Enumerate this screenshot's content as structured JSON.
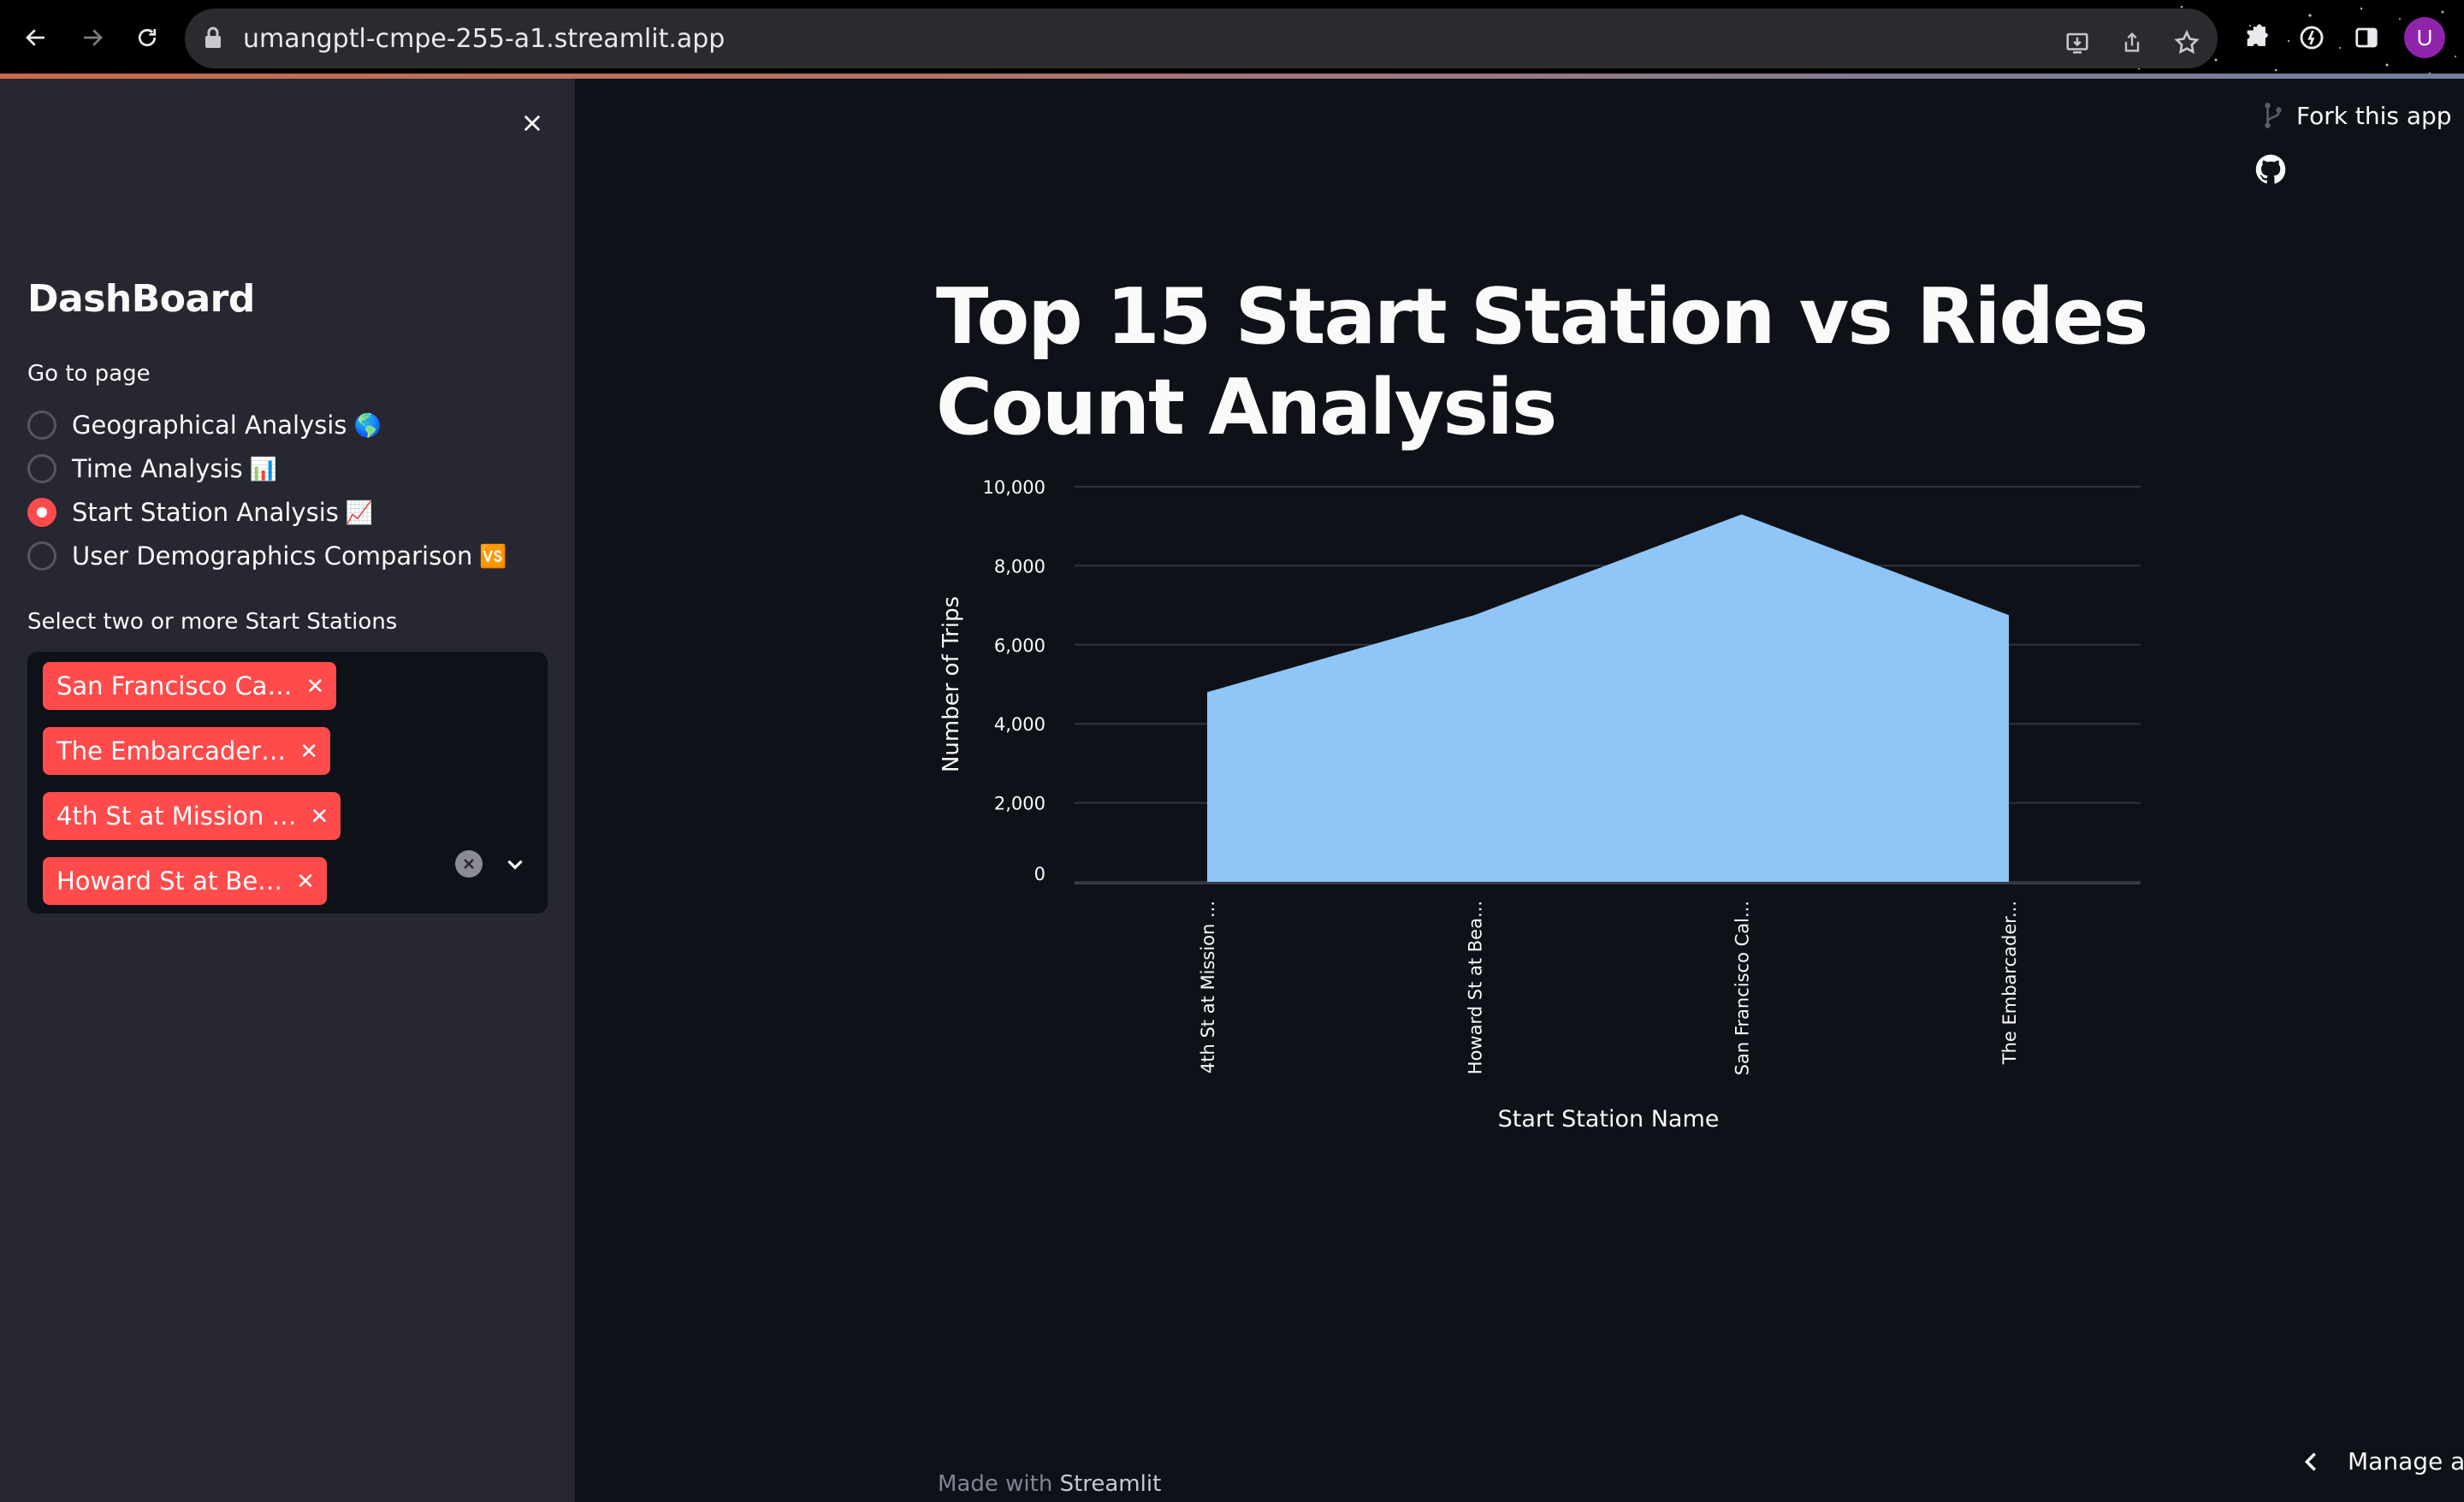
{
  "browser": {
    "url": "umangptl-cmpe-255-a1.streamlit.app",
    "profile_initial": "U"
  },
  "sidebar": {
    "title": "DashBoard",
    "nav_label": "Go to page",
    "pages": [
      {
        "label": "Geographical Analysis",
        "emoji": "🌎",
        "selected": false
      },
      {
        "label": "Time Analysis",
        "emoji": "📊",
        "selected": false
      },
      {
        "label": "Start Station Analysis",
        "emoji": "📈",
        "selected": true
      },
      {
        "label": "User Demographics Comparison",
        "emoji": "🆚",
        "selected": false
      }
    ],
    "multiselect_label": "Select two or more Start Stations",
    "selected_stations": [
      "San Francisco Ca…",
      "The Embarcader…",
      "4th St at Mission …",
      "Howard St at Be…"
    ]
  },
  "header": {
    "fork_label": "Fork this app"
  },
  "main": {
    "title": "Top 15 Start Station vs Rides Count Analysis"
  },
  "chart_data": {
    "type": "area",
    "categories": [
      "4th St at Mission ...",
      "Howard St at Bea...",
      "San Francisco Cal...",
      "The Embarcader..."
    ],
    "values": [
      4800,
      6750,
      9300,
      6750
    ],
    "xlabel": "Start Station Name",
    "ylabel": "Number of Trips",
    "ylim": [
      0,
      10000
    ],
    "yticks": [
      0,
      2000,
      4000,
      6000,
      8000,
      10000
    ],
    "ytick_labels": [
      "0",
      "2,000",
      "4,000",
      "6,000",
      "8,000",
      "10,000"
    ],
    "grid": true,
    "fill_color": "#90c5f7"
  },
  "footer": {
    "prefix": "Made with",
    "brand": "Streamlit",
    "manage_label": "Manage app"
  }
}
